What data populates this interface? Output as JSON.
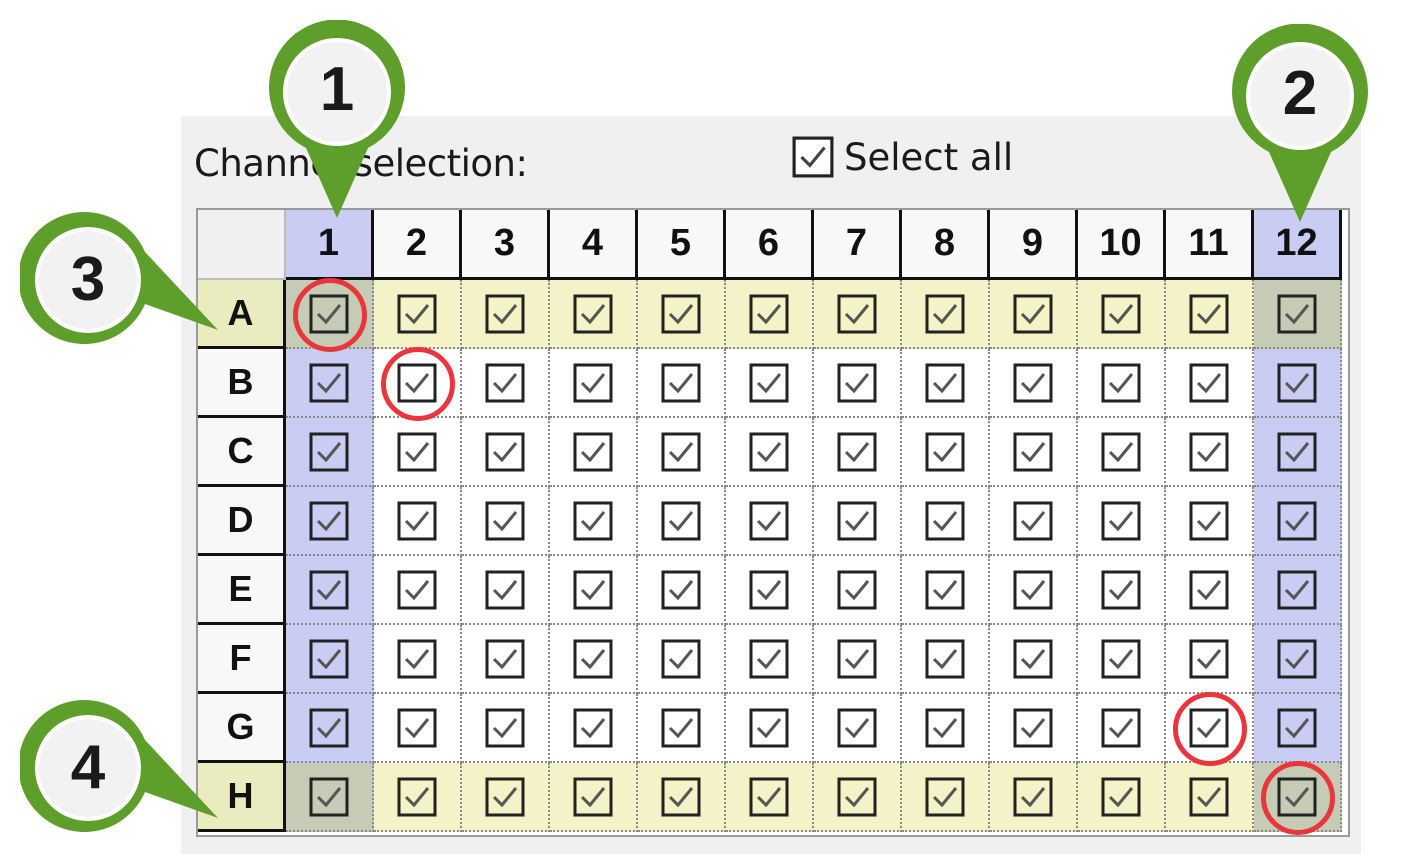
{
  "panel": {
    "label": "Channel selection:",
    "select_all_label": "Select all",
    "select_all_checked": true
  },
  "grid": {
    "columns": [
      "1",
      "2",
      "3",
      "4",
      "5",
      "6",
      "7",
      "8",
      "9",
      "10",
      "11",
      "12"
    ],
    "rows": [
      "A",
      "B",
      "C",
      "D",
      "E",
      "F",
      "G",
      "H"
    ],
    "all_checked": true,
    "highlighted_columns": [
      "1",
      "12"
    ],
    "highlighted_rows": [
      "A",
      "H"
    ]
  },
  "callouts": [
    {
      "number": "1",
      "target": "column 1 header"
    },
    {
      "number": "2",
      "target": "column 12 header"
    },
    {
      "number": "3",
      "target": "row A header"
    },
    {
      "number": "4",
      "target": "row H header"
    }
  ],
  "red_circles": [
    "A1",
    "B2",
    "G11",
    "H12"
  ],
  "colors": {
    "column_highlight": "#c9cdf3",
    "row_highlight": "#f3f3c7",
    "callout_green": "#5e9e2a",
    "circle_red": "#e8363c"
  }
}
